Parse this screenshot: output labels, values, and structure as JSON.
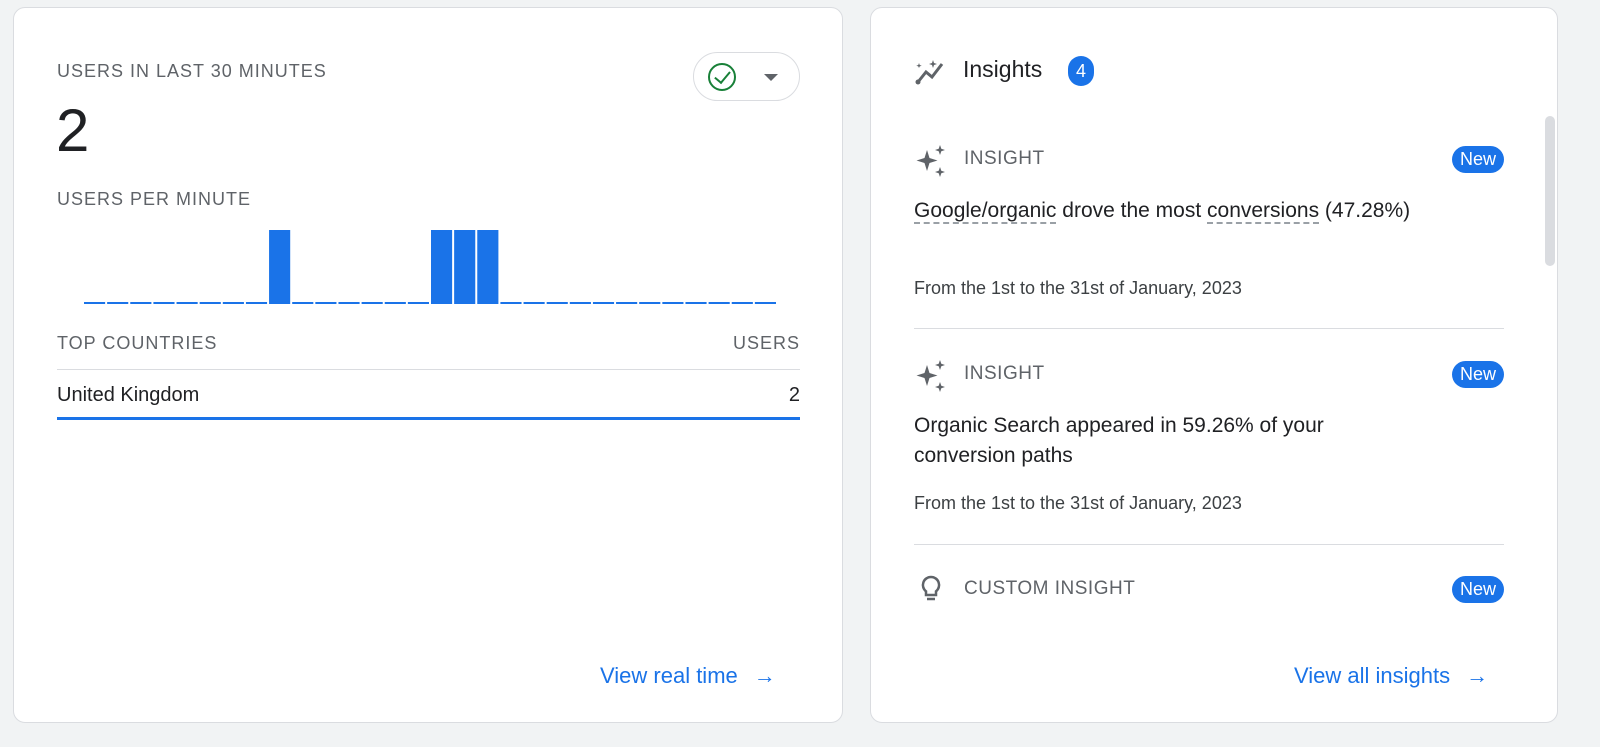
{
  "realtime": {
    "title": "USERS IN LAST 30 MINUTES",
    "value": "2",
    "per_minute_label": "USERS PER MINUTE",
    "table": {
      "col1": "TOP COUNTRIES",
      "col2": "USERS",
      "rows": [
        {
          "country": "United Kingdom",
          "users": "2"
        }
      ]
    },
    "link": "View real time",
    "status_icon": "check-circle-icon"
  },
  "chart_data": {
    "type": "bar",
    "title": "USERS PER MINUTE",
    "values": [
      0,
      0,
      0,
      0,
      0,
      0,
      0,
      0,
      1,
      0,
      0,
      0,
      0,
      0,
      0,
      1,
      1,
      1,
      0,
      0,
      0,
      0,
      0,
      0,
      0,
      0,
      0,
      0,
      0,
      0
    ],
    "color": "#1a73e8"
  },
  "insights": {
    "title": "Insights",
    "count": "4",
    "items": [
      {
        "type": "INSIGHT",
        "badge": "New",
        "text_a": "Google/organic",
        "text_b": " drove the most ",
        "text_c": "conversions",
        "text_d": " (47.28%)",
        "date": "From the 1st to the 31st of January, 2023"
      },
      {
        "type": "INSIGHT",
        "badge": "New",
        "text": "Organic Search appeared in 59.26% of your conversion paths",
        "date": "From the 1st to the 31st of January, 2023"
      },
      {
        "type": "CUSTOM INSIGHT",
        "badge": "New"
      }
    ],
    "link": "View all insights"
  },
  "colors": {
    "accent": "#1a73e8",
    "success": "#188038"
  }
}
